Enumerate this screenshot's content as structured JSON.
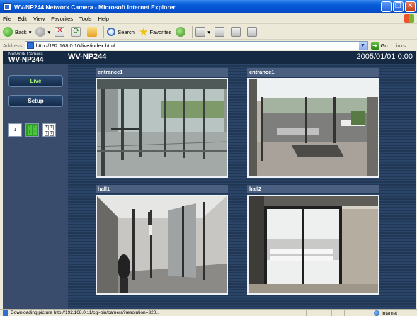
{
  "window": {
    "title": "WV-NP244 Network Camera - Microsoft Internet Explorer",
    "controls": [
      "_",
      "❐",
      "✕"
    ]
  },
  "menu": [
    "File",
    "Edit",
    "View",
    "Favorites",
    "Tools",
    "Help"
  ],
  "toolbar": {
    "back": "Back",
    "search": "Search",
    "favorites": "Favorites"
  },
  "address": {
    "label": "Address",
    "url": "http://192.168.0.10/live/index.html",
    "go": "Go",
    "links": "Links"
  },
  "page": {
    "brand_small": "Network Camera",
    "brand_big": "WV-NP244",
    "model_title": "WV-NP244",
    "datetime": "2005/01/01 0:00",
    "nav": {
      "live": "Live",
      "setup": "Setup"
    },
    "layout_buttons": {
      "single": "1",
      "quad_a": [
        "1",
        "2",
        "3",
        "4"
      ],
      "quad_b": [
        "5",
        "6",
        "7",
        "8"
      ]
    },
    "cameras": [
      {
        "label": "entrance1"
      },
      {
        "label": "entrance1"
      },
      {
        "label": "hall1"
      },
      {
        "label": "hall2"
      }
    ]
  },
  "status": {
    "text": "Downloading picture http://192.168.0.11/cgi-bin/camera?resolution=320...",
    "zone": "Internet"
  }
}
